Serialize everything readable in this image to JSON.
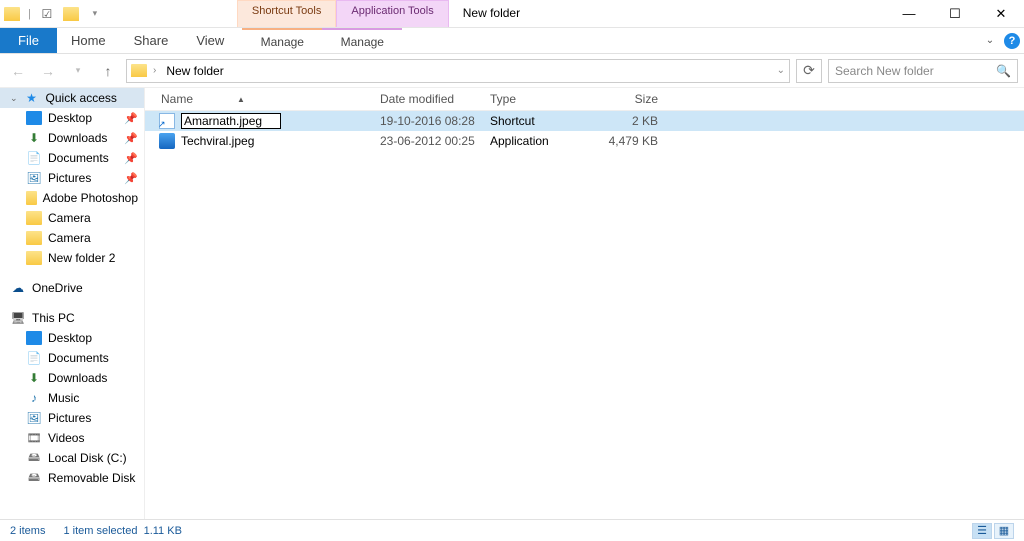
{
  "title": "New folder",
  "tool_tabs": {
    "shortcut": "Shortcut Tools",
    "application": "Application Tools"
  },
  "ribbon": {
    "file": "File",
    "home": "Home",
    "share": "Share",
    "view": "View",
    "manage": "Manage"
  },
  "breadcrumb": {
    "location": "New folder"
  },
  "search": {
    "placeholder": "Search New folder"
  },
  "columns": {
    "name": "Name",
    "date": "Date modified",
    "type": "Type",
    "size": "Size"
  },
  "files": [
    {
      "name": "Amarnath.jpeg",
      "date": "19-10-2016 08:28",
      "type": "Shortcut",
      "size": "2 KB",
      "selected": true,
      "renaming": true,
      "icon": "shortcut"
    },
    {
      "name": "Techviral.jpeg",
      "date": "23-06-2012 00:25",
      "type": "Application",
      "size": "4,479 KB",
      "selected": false,
      "renaming": false,
      "icon": "app"
    }
  ],
  "nav": {
    "quick_access": "Quick access",
    "quick_items": [
      {
        "label": "Desktop",
        "pinned": true,
        "icon": "blue"
      },
      {
        "label": "Downloads",
        "pinned": true,
        "icon": "dl"
      },
      {
        "label": "Documents",
        "pinned": true,
        "icon": "doc"
      },
      {
        "label": "Pictures",
        "pinned": true,
        "icon": "pic"
      },
      {
        "label": "Adobe Photoshop",
        "pinned": false,
        "icon": "folder"
      },
      {
        "label": "Camera",
        "pinned": false,
        "icon": "folder"
      },
      {
        "label": "Camera",
        "pinned": false,
        "icon": "folder"
      },
      {
        "label": "New folder 2",
        "pinned": false,
        "icon": "folder"
      }
    ],
    "onedrive": "OneDrive",
    "this_pc": "This PC",
    "pc_items": [
      {
        "label": "Desktop",
        "icon": "blue"
      },
      {
        "label": "Documents",
        "icon": "doc"
      },
      {
        "label": "Downloads",
        "icon": "dl"
      },
      {
        "label": "Music",
        "icon": "music"
      },
      {
        "label": "Pictures",
        "icon": "pic"
      },
      {
        "label": "Videos",
        "icon": "vid"
      },
      {
        "label": "Local Disk (C:)",
        "icon": "disk"
      },
      {
        "label": "Removable Disk",
        "icon": "disk"
      }
    ]
  },
  "status": {
    "count": "2 items",
    "selected": "1 item selected",
    "size": "1.11 KB"
  }
}
